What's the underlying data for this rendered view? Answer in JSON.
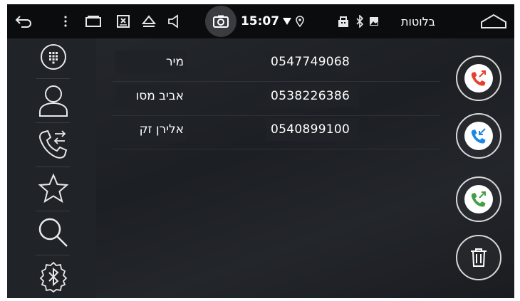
{
  "status_bar": {
    "time": "15:07",
    "title": "בלוטות",
    "icons": [
      "back-icon",
      "more-icon",
      "recent-apps-icon",
      "screenshot-box-icon",
      "eject-icon",
      "volume-icon",
      "camera-icon",
      "signal-icon",
      "location-icon",
      "usb-icon",
      "bluetooth-icon",
      "image-icon",
      "home-icon"
    ]
  },
  "nav": {
    "items": [
      {
        "name": "dialpad",
        "icon": "dialpad-icon"
      },
      {
        "name": "contacts",
        "icon": "person-icon"
      },
      {
        "name": "call-log",
        "icon": "phone-transfer-icon"
      },
      {
        "name": "favorites",
        "icon": "star-icon"
      },
      {
        "name": "search",
        "icon": "search-icon"
      },
      {
        "name": "bluetooth-settings",
        "icon": "bluetooth-icon"
      }
    ]
  },
  "call_list": [
    {
      "name": "מיר",
      "number": "0547749068"
    },
    {
      "name": "אביב מסו",
      "number": "0538226386"
    },
    {
      "name": "אלירן זק",
      "number": "0540899100"
    }
  ],
  "actions": [
    {
      "name": "missed-calls",
      "icon": "missed-call-icon",
      "color": "#e8402e"
    },
    {
      "name": "incoming-calls",
      "icon": "incoming-call-icon",
      "color": "#1e88e5"
    },
    {
      "name": "outgoing-calls",
      "icon": "outgoing-call-icon",
      "color": "#43a047"
    },
    {
      "name": "delete",
      "icon": "trash-icon",
      "color": "#ffffff"
    }
  ]
}
